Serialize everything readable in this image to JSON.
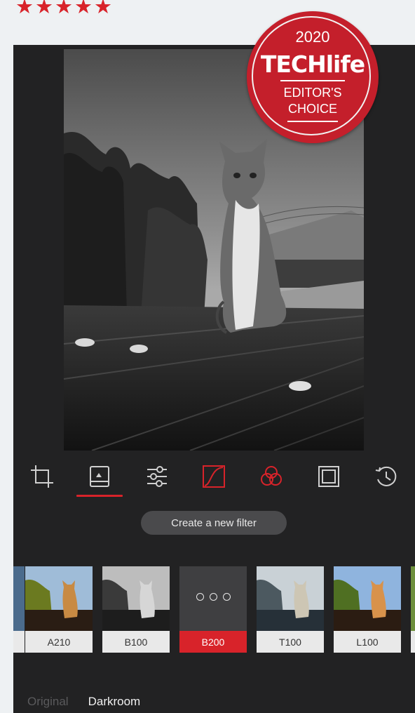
{
  "rating": {
    "stars": 5,
    "star_glyph": "★",
    "star_color": "#d8232a"
  },
  "badge": {
    "year": "2020",
    "brand": "TECHlife",
    "line1": "EDITOR'S",
    "line2": "CHOICE",
    "color": "#c41f2b"
  },
  "toolbar": {
    "tools": [
      {
        "name": "crop-icon",
        "active": false
      },
      {
        "name": "filters-icon",
        "active": true
      },
      {
        "name": "adjust-sliders-icon",
        "active": false
      },
      {
        "name": "curves-icon",
        "active": false,
        "accent": true
      },
      {
        "name": "color-channels-icon",
        "active": false,
        "accent": true
      },
      {
        "name": "frame-icon",
        "active": false
      },
      {
        "name": "history-icon",
        "active": false
      }
    ]
  },
  "create_filter": {
    "label": "Create a new filter"
  },
  "filters": [
    {
      "label": "A210",
      "style": "color"
    },
    {
      "label": "B100",
      "style": "bw"
    },
    {
      "label": "B200",
      "style": "selected"
    },
    {
      "label": "T100",
      "style": "toned"
    },
    {
      "label": "L100",
      "style": "color"
    }
  ],
  "bottom_tabs": {
    "original": "Original",
    "darkroom": "Darkroom"
  },
  "colors": {
    "accent": "#d8232a",
    "panel": "#222223",
    "background": "#eef1f3"
  }
}
